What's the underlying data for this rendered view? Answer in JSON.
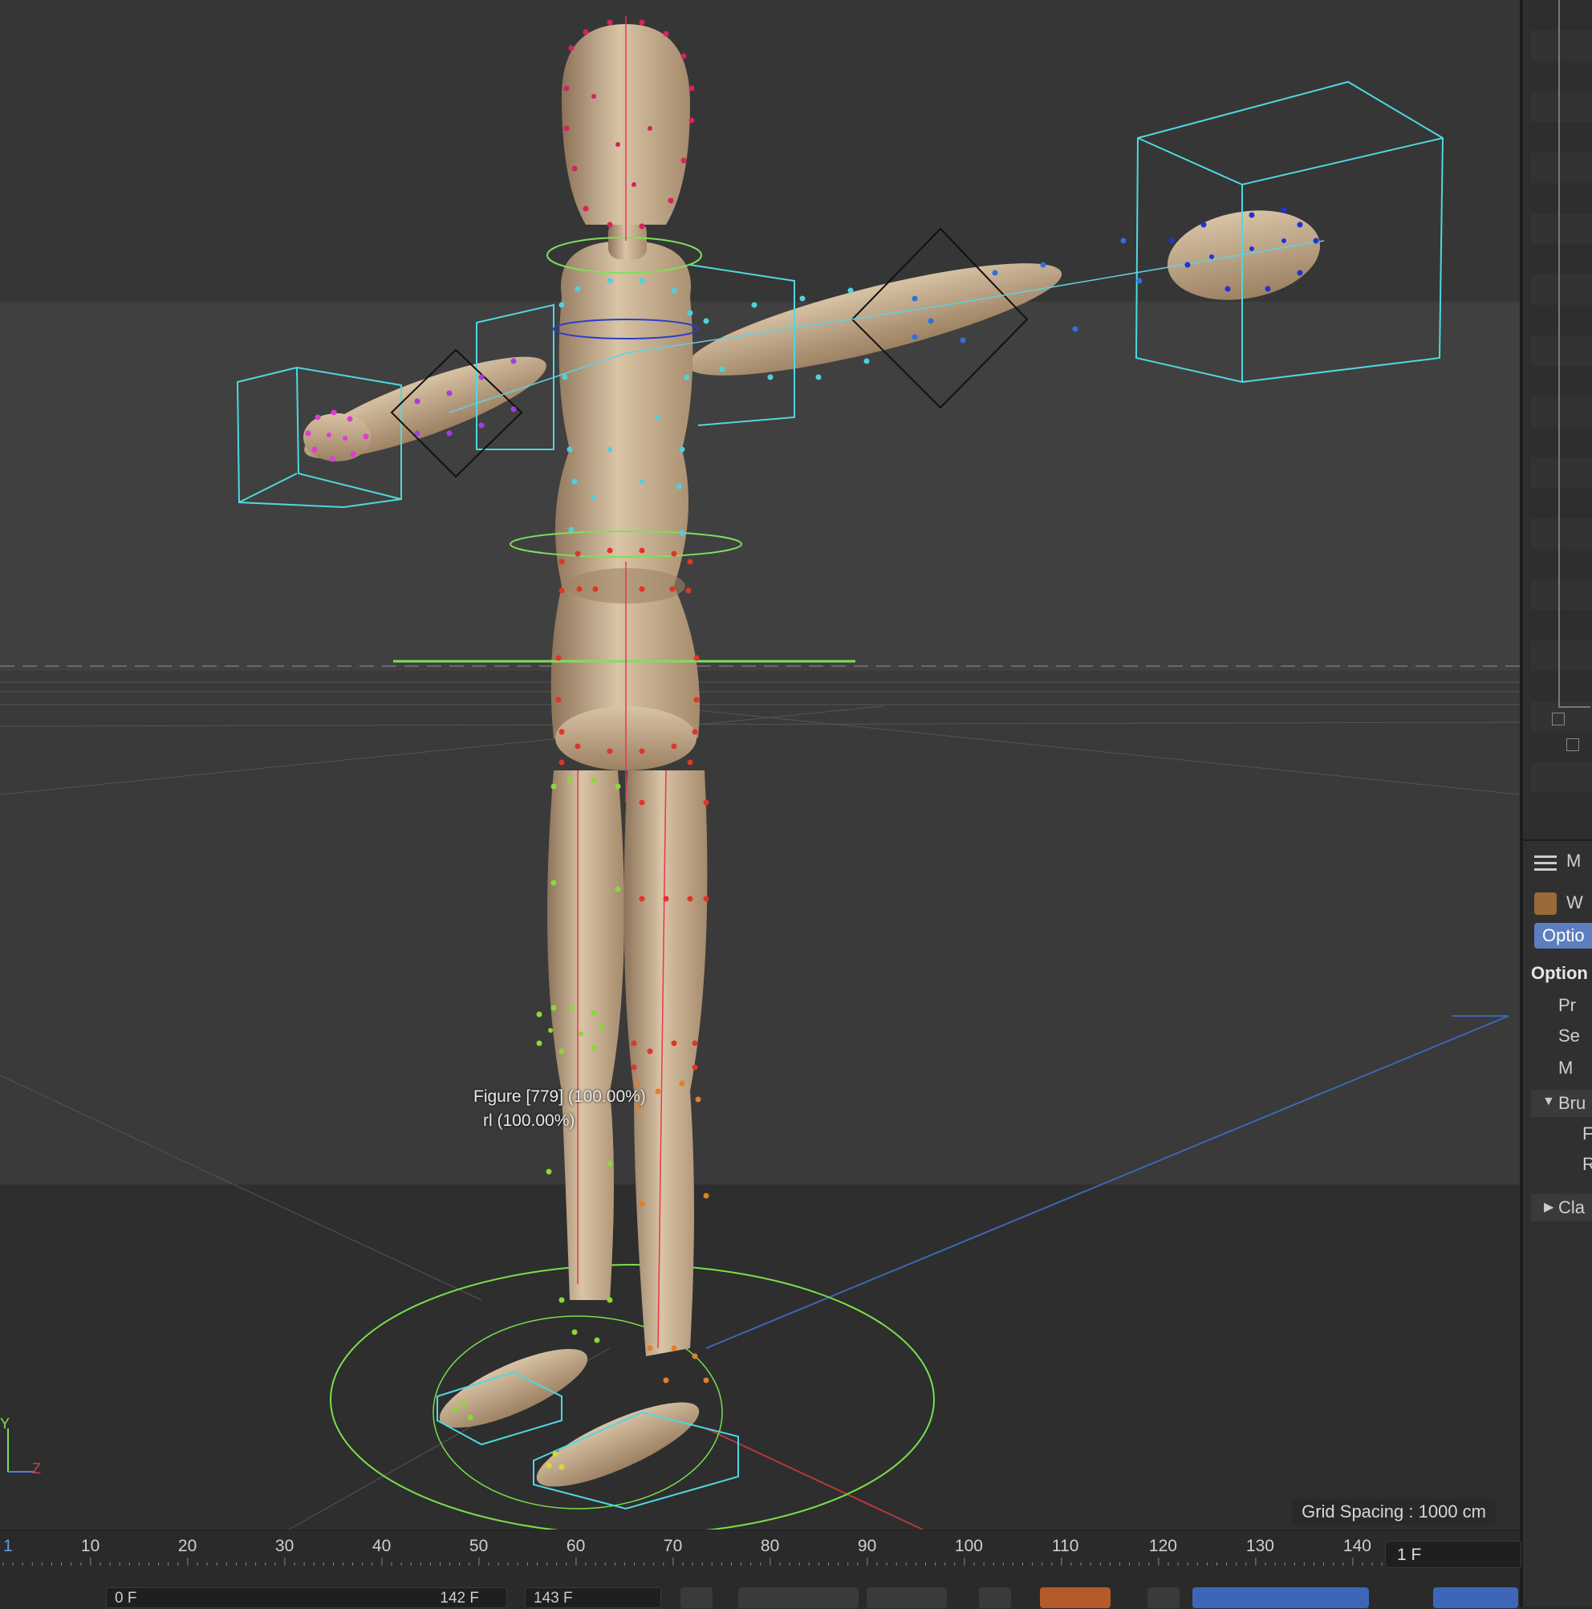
{
  "viewport": {
    "grid_spacing": "Grid Spacing : 1000 cm",
    "tooltip_line1": "Figure [779] (100.00%)",
    "tooltip_line2": "rl (100.00%)",
    "axis_y": "Y",
    "axis_z": "Z"
  },
  "right_panel": {
    "menu_letter": "M",
    "tool_name": "W",
    "tab_label": "Optio",
    "section_label": "Option",
    "rows": [
      "Pr",
      "Se",
      "M"
    ],
    "group_brush": "Bru",
    "group_brush_rows": [
      "F",
      "R"
    ],
    "group_cla": "Cla"
  },
  "timeline": {
    "ruler_labels": [
      "1",
      "10",
      "20",
      "30",
      "40",
      "50",
      "60",
      "70",
      "80",
      "90",
      "100",
      "110",
      "120",
      "130",
      "140"
    ],
    "current_frame": "1 F",
    "start_field": "0 F",
    "end_field": "142 F",
    "max_field": "143 F"
  },
  "colors": {
    "viewport_bg": "#363636",
    "selection_blue": "#5c7fc0",
    "cyan_wire": "#4fd8e0",
    "green_wire": "#7ee05a"
  }
}
